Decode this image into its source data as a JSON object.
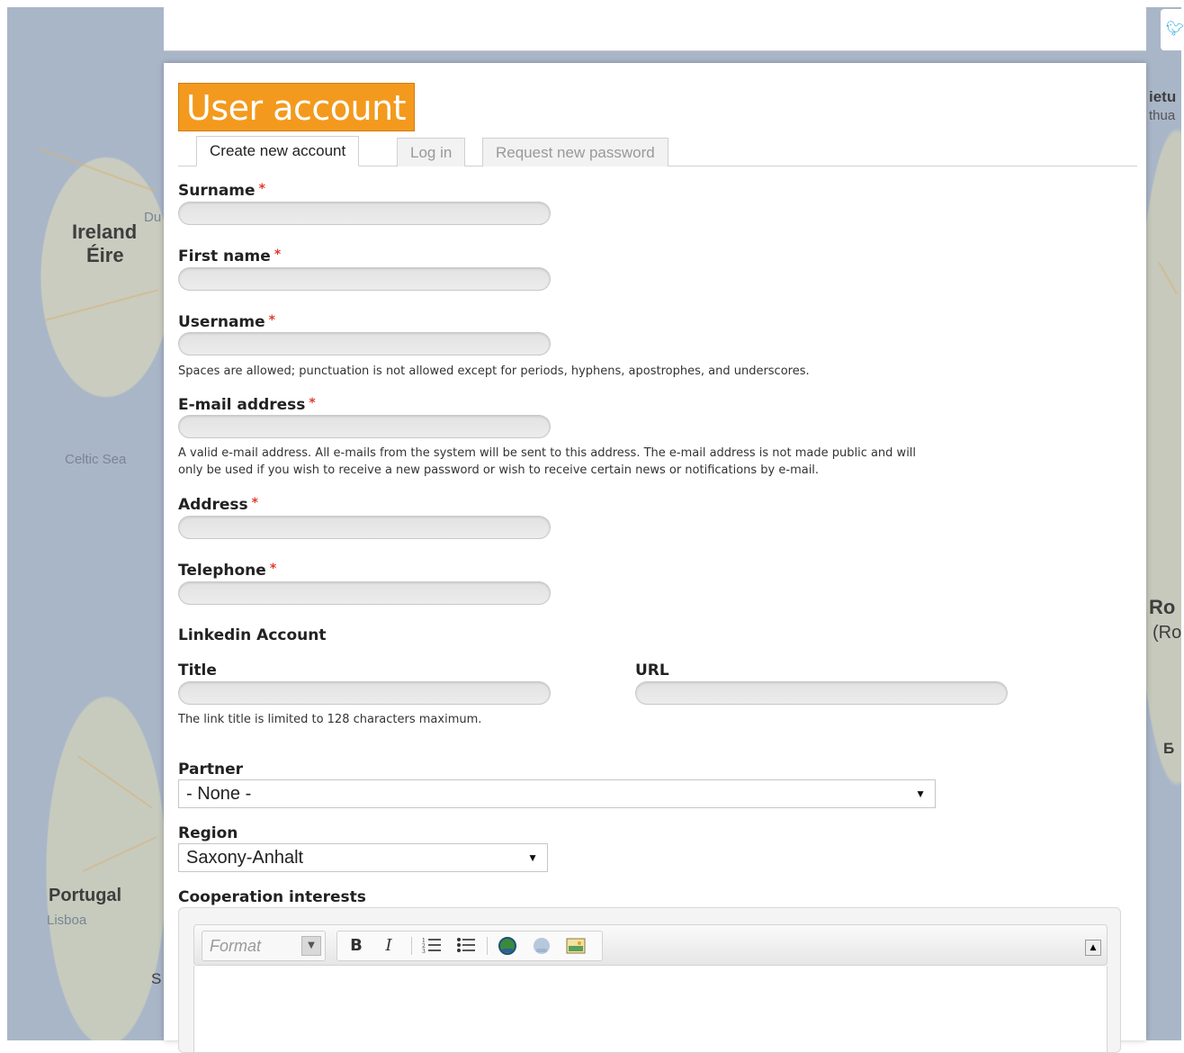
{
  "map": {
    "labels": [
      "Ireland",
      "Éire",
      "Celtic Sea",
      "Portugal",
      "Lisboa",
      "Du",
      "S",
      "ietu",
      "thua",
      "Ro",
      "(Ro",
      "Б"
    ]
  },
  "page": {
    "title": "User account",
    "tabs": [
      "Create new account",
      "Log in",
      "Request new password"
    ]
  },
  "form": {
    "surname_label": "Surname",
    "first_name_label": "First name",
    "username_label": "Username",
    "username_hint": "Spaces are allowed; punctuation is not allowed except for periods, hyphens, apostrophes, and underscores.",
    "email_label": "E-mail address",
    "email_hint_line1": "A valid e-mail address. All e-mails from the system will be sent to this address. The e-mail address is not made public and will",
    "email_hint_line2": "only be used if you wish to receive a new password or wish to receive certain news or notifications by e-mail.",
    "address_label": "Address",
    "telephone_label": "Telephone",
    "required_mark": "*",
    "linkedin_heading": "Linkedin Account",
    "title_label": "Title",
    "url_label": "URL",
    "title_hint": "The link title is limited to 128 characters maximum.",
    "partner_label": "Partner",
    "partner_value": "- None -",
    "region_label": "Region",
    "region_value": "Saxony-Anhalt",
    "cooperation_label": "Cooperation interests"
  },
  "editor": {
    "format_placeholder": "Format",
    "buttons": {
      "bold": "B",
      "italic": "I"
    }
  },
  "colors": {
    "title_bg": "#f39a1e",
    "required": "#e23b2c"
  }
}
